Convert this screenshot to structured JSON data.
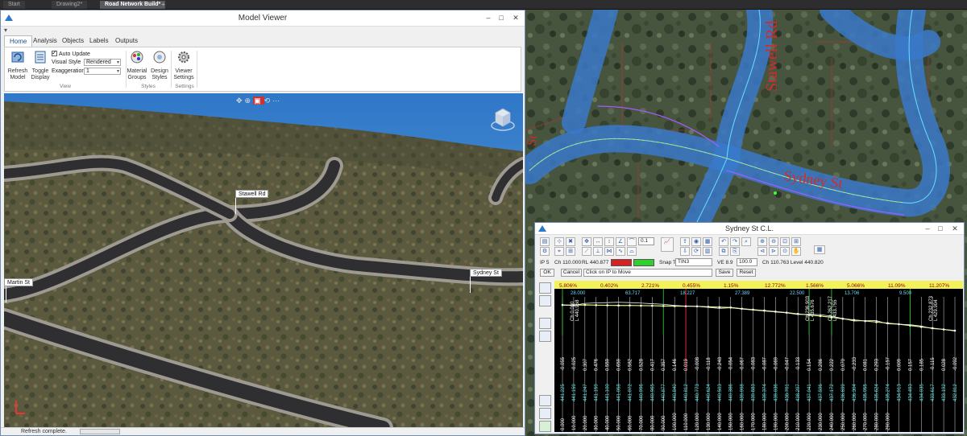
{
  "app_tabs": [
    "Start",
    "Drawing2*",
    "Road Network Build*"
  ],
  "model_viewer": {
    "title": "Model Viewer",
    "ribbon_tabs": [
      "Home",
      "Analysis",
      "Objects",
      "Labels",
      "Outputs"
    ],
    "buttons": {
      "refresh": "Refresh Model",
      "toggle": "Toggle Display",
      "material": "Material Groups",
      "design": "Design Styles",
      "viewer_settings": "Viewer Settings"
    },
    "auto_update": "Auto Update",
    "visual_style_label": "Visual Style",
    "visual_style_value": "Rendered",
    "exaggeration_label": "Exaggeration",
    "exaggeration_value": "1",
    "groups": {
      "view": "View",
      "styles": "Styles",
      "settings": "Settings"
    },
    "road_labels": {
      "stawell": "Stawell Rd",
      "sydney": "Sydney St",
      "martin": "Martin St"
    },
    "status": "Refresh complete."
  },
  "map": {
    "labels": {
      "stawell": "Stawell Rd",
      "sydney": "Sydney St",
      "left_st": "St"
    }
  },
  "profile_window": {
    "title": "Sydney St C.L.",
    "ip": "IP 5",
    "ch": "Ch 110.000",
    "rl": "RL 440.877",
    "snap_label": "Snap To",
    "snap_value": "TIN3",
    "ve_label": "VE 8.9",
    "scale_value": "100.0",
    "ch_level": "Ch 110.763 Level 440.820",
    "zoom_value": "0.1",
    "ok": "OK",
    "cancel": "Cancel",
    "prompt": "Click on IP to Move",
    "save": "Save",
    "reset": "Reset"
  },
  "profile_data": {
    "grades": [
      "5.806%",
      "0.402%",
      "2.721%",
      "0.455%",
      "1.15%",
      "12.772%",
      "1.566%",
      "5.066%",
      "11.09%",
      "11.207%"
    ],
    "vc_lengths": [
      "28.000",
      "63.717",
      "18.227",
      "27.389",
      "22.500",
      "13.706",
      "9.500"
    ],
    "chainage_labels": [
      "Ch 0.000",
      "Ch 236.903",
      "Ch 262.217",
      "Ch 232.873"
    ],
    "level_labels": [
      "L 440.958",
      "L 435.676",
      "L 433.755",
      "L 429.904"
    ],
    "cut_fill": [
      "-0.055",
      "-0.025",
      "0.307",
      "0.476",
      "0.559",
      "0.659",
      "0.582",
      "0.528",
      "0.417",
      "0.357",
      "0.146",
      "0.019",
      "-0.008",
      "-0.118",
      "-0.248",
      "-0.054",
      "-0.067",
      "-0.083",
      "-0.087",
      "-0.069",
      "-0.047",
      "-0.133",
      "0.154",
      "0.286",
      "0.222",
      "0.070",
      "-0.233",
      "0.081",
      "0.293",
      "-0.157",
      "0.009",
      "0.157",
      "0.185",
      "-0.115",
      "0.028",
      "-0.092"
    ],
    "design_levels": [
      "441.225",
      "441.159",
      "441.247",
      "441.159",
      "441.100",
      "441.058",
      "441.072",
      "440.996",
      "440.965",
      "440.877",
      "440.840",
      "440.812",
      "440.773",
      "440.624",
      "440.503",
      "440.386",
      "439.998",
      "439.683",
      "439.374",
      "439.036",
      "438.701",
      "438.297",
      "437.941",
      "437.596",
      "437.172",
      "436.699",
      "436.304",
      "435.955",
      "435.624",
      "435.274",
      "434.913",
      "434.493",
      "434.035",
      "433.617",
      "433.192",
      "432.812"
    ],
    "chainages": [
      "0.000",
      "10.000",
      "20.000",
      "30.000",
      "40.000",
      "50.000",
      "60.000",
      "70.000",
      "80.000",
      "90.000",
      "100.000",
      "110.000",
      "120.000",
      "130.000",
      "140.000",
      "150.000",
      "160.000",
      "170.000",
      "180.000",
      "190.000",
      "200.000",
      "210.000",
      "220.000",
      "230.000",
      "240.000",
      "250.000",
      "260.000",
      "270.000",
      "280.000",
      "290.000"
    ]
  }
}
